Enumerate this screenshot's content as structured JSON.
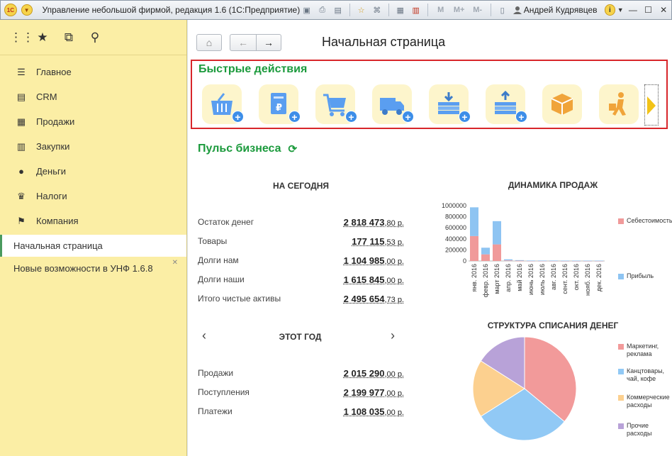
{
  "window": {
    "title": "Управление небольшой фирмой, редакция 1.6  (1С:Предприятие)",
    "logo_text": "1C",
    "user": "Андрей Кудрявцев",
    "m_buttons": [
      "M",
      "M+",
      "M-"
    ]
  },
  "sidebar": {
    "nav": [
      {
        "label": "Главное",
        "icon": "menu-lines-icon"
      },
      {
        "label": "CRM",
        "icon": "contact-card-icon"
      },
      {
        "label": "Продажи",
        "icon": "basket-icon"
      },
      {
        "label": "Закупки",
        "icon": "cart-icon"
      },
      {
        "label": "Деньги",
        "icon": "ruble-coin-icon"
      },
      {
        "label": "Налоги",
        "icon": "eagle-icon"
      },
      {
        "label": "Компания",
        "icon": "flag-icon"
      }
    ],
    "open_tabs": [
      {
        "label": "Начальная страница",
        "active": true
      },
      {
        "label": "Новые возможности в УНФ 1.6.8",
        "active": false
      }
    ]
  },
  "main": {
    "page_title": "Начальная страница",
    "quick_actions_title": "Быстрые действия",
    "quick_actions": [
      "basket-plus-icon",
      "invoice-plus-icon",
      "cart-plus-icon",
      "truck-plus-icon",
      "money-in-plus-icon",
      "money-out-plus-icon",
      "box-icon",
      "worker-icon"
    ],
    "pulse_title": "Пульс бизнеса",
    "today": {
      "heading": "НА СЕГОДНЯ",
      "rows": [
        {
          "label": "Остаток денег",
          "int": "2 818 473",
          "frac": ",80 р."
        },
        {
          "label": "Товары",
          "int": "177 115",
          "frac": ",53 р."
        },
        {
          "label": "Долги нам",
          "int": "1 104 985",
          "frac": ",00 р."
        },
        {
          "label": "Долги наши",
          "int": "1 615 845",
          "frac": ",00 р."
        },
        {
          "label": "Итого чистые активы",
          "int": "2 495 654",
          "frac": ",73 р."
        }
      ]
    },
    "year": {
      "heading": "ЭТОТ ГОД",
      "rows": [
        {
          "label": "Продажи",
          "int": "2 015 290",
          "frac": ",00 р."
        },
        {
          "label": "Поступления",
          "int": "2 199 977",
          "frac": ",00 р."
        },
        {
          "label": "Платежи",
          "int": "1 108 035",
          "frac": ",00 р."
        }
      ]
    }
  },
  "chart_data": [
    {
      "type": "bar",
      "title": "ДИНАМИКА ПРОДАЖ",
      "stacked": true,
      "categories": [
        "янв. 2016",
        "февр. 2016",
        "март 2016",
        "апр. 2016",
        "май 2016",
        "июнь 2016",
        "июль 2016",
        "авг. 2016",
        "сент. 2016",
        "окт. 2016",
        "нояб. 2016",
        "дек. 2016"
      ],
      "series": [
        {
          "name": "Себестоимость",
          "color": "#f09a9a",
          "values": [
            450000,
            120000,
            300000,
            10000,
            5000,
            3000,
            3000,
            3000,
            2000,
            2000,
            2000,
            2000
          ]
        },
        {
          "name": "Прибыль",
          "color": "#8ec4f2",
          "values": [
            520000,
            120000,
            420000,
            20000,
            10000,
            5000,
            5000,
            5000,
            5000,
            5000,
            5000,
            5000
          ]
        }
      ],
      "yticks": [
        "1000000",
        "800000",
        "600000",
        "400000",
        "200000",
        "0"
      ],
      "ylim": [
        0,
        1000000
      ],
      "legend_position": "right"
    },
    {
      "type": "pie",
      "title": "СТРУКТУРА СПИСАНИЯ ДЕНЕГ",
      "slices": [
        {
          "label": "Маркетинг, реклама",
          "value": 36,
          "color": "#f29a9a"
        },
        {
          "label": "Канцтовары, чай, кофе",
          "value": 30,
          "color": "#91c9f5"
        },
        {
          "label": "Коммерческие расходы",
          "value": 18,
          "color": "#fcd08f"
        },
        {
          "label": "Прочие расходы",
          "value": 16,
          "color": "#b8a2d8"
        }
      ],
      "legend_position": "right"
    }
  ]
}
